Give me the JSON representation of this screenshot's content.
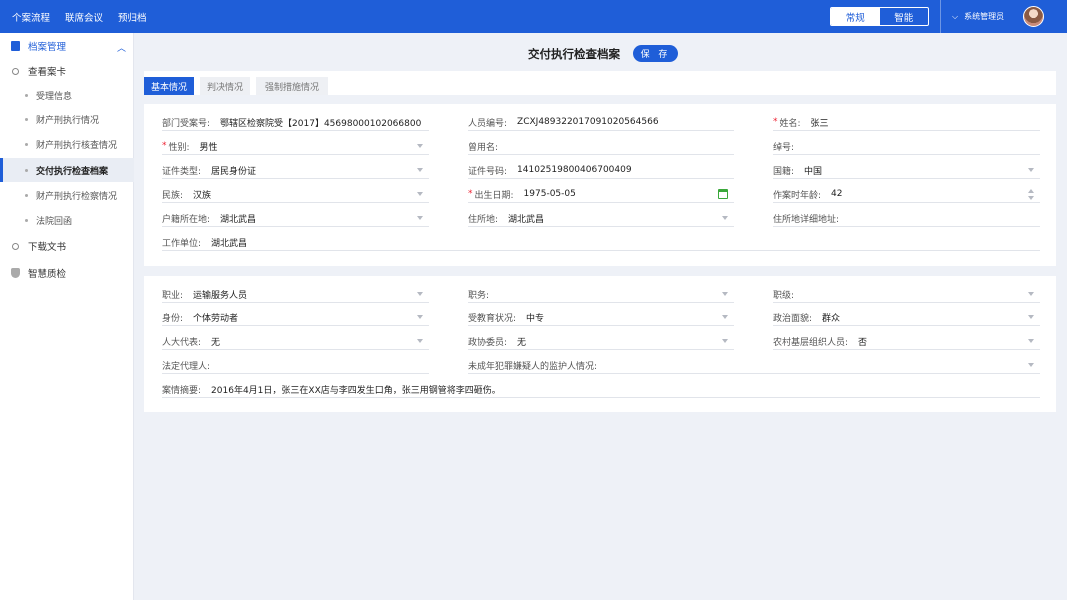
{
  "topbar": {
    "nav": [
      "个案流程",
      "联席会议",
      "预归档"
    ],
    "mode_options": [
      "常规",
      "智能"
    ],
    "selected_mode": "常规",
    "user_name": "系统管理员"
  },
  "sidebar": {
    "section_title": "档案管理",
    "group_title": "查看案卡",
    "items": [
      "受理信息",
      "财产刑执行情况",
      "财产刑执行核查情况",
      "交付执行检查档案",
      "财产刑执行检察情况",
      "法院回函"
    ],
    "active_item": "交付执行检查档案",
    "extra": [
      "下载文书",
      "智慧质检"
    ]
  },
  "main": {
    "title": "交付执行检查档案",
    "save_label": "保 存",
    "tabs": [
      "基本情况",
      "判决情况",
      "强制措施情况"
    ],
    "active_tab": "基本情况"
  },
  "form1": {
    "dept_case_no": {
      "label": "部门受案号:",
      "value": "鄂辖区检察院受【2017】45698000102066800"
    },
    "person_no": {
      "label": "人员编号:",
      "value": "ZCXJ489322017091020564566"
    },
    "name": {
      "label": "姓名:",
      "value": "张三"
    },
    "gender": {
      "label": "性别:",
      "value": "男性"
    },
    "former_name": {
      "label": "曾用名:",
      "value": ""
    },
    "nickname": {
      "label": "绰号:",
      "value": ""
    },
    "id_type": {
      "label": "证件类型:",
      "value": "居民身份证"
    },
    "id_no": {
      "label": "证件号码:",
      "value": "14102519800406700409"
    },
    "nationality": {
      "label": "国籍:",
      "value": "中国"
    },
    "ethnicity": {
      "label": "民族:",
      "value": "汉族"
    },
    "birth_date": {
      "label": "出生日期:",
      "value": "1975-05-05"
    },
    "crime_age": {
      "label": "作案时年龄:",
      "value": "42"
    },
    "household": {
      "label": "户籍所在地:",
      "value": "湖北武昌"
    },
    "residence": {
      "label": "住所地:",
      "value": "湖北武昌"
    },
    "residence_detail": {
      "label": "住所地详细地址:",
      "value": ""
    },
    "work_unit": {
      "label": "工作单位:",
      "value": "湖北武昌"
    }
  },
  "form2": {
    "occupation": {
      "label": "职业:",
      "value": "运输服务人员"
    },
    "position": {
      "label": "职务:",
      "value": ""
    },
    "rank": {
      "label": "职级:",
      "value": ""
    },
    "identity": {
      "label": "身份:",
      "value": "个体劳动者"
    },
    "education": {
      "label": "受教育状况:",
      "value": "中专"
    },
    "political": {
      "label": "政治面貌:",
      "value": "群众"
    },
    "npc_rep": {
      "label": "人大代表:",
      "value": "无"
    },
    "cppcc": {
      "label": "政协委员:",
      "value": "无"
    },
    "rural_org": {
      "label": "农村基层组织人员:",
      "value": "否"
    },
    "legal_agent": {
      "label": "法定代理人:",
      "value": ""
    },
    "guardian": {
      "label": "未成年犯罪嫌疑人的监护人情况:",
      "value": ""
    },
    "case_summary": {
      "label": "案情摘要:",
      "value": "2016年4月1日，张三在XX店与李四发生口角，张三用钢管将李四砸伤。"
    }
  }
}
